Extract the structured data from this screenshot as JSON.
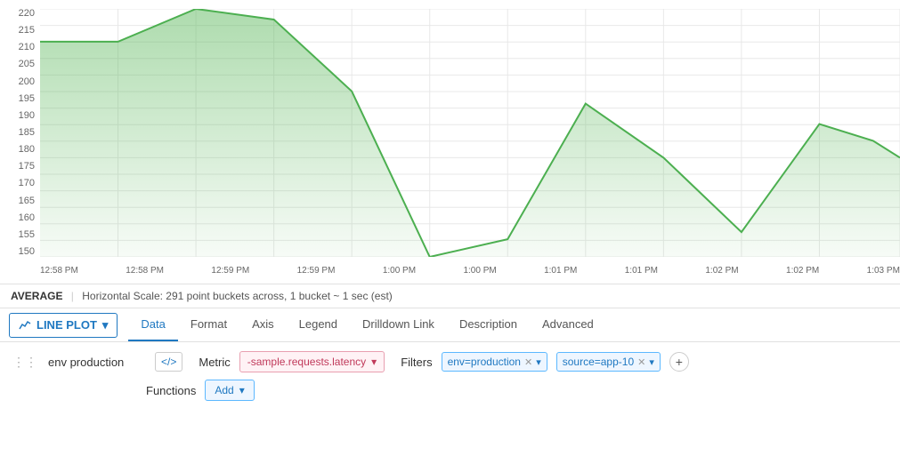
{
  "chart": {
    "y_labels": [
      "220",
      "215",
      "210",
      "205",
      "200",
      "195",
      "190",
      "185",
      "180",
      "175",
      "170",
      "165",
      "160",
      "155",
      "150"
    ],
    "x_labels": [
      "12:58 PM",
      "12:58 PM",
      "12:59 PM",
      "12:59 PM",
      "1:00 PM",
      "1:00 PM",
      "1:01 PM",
      "1:01 PM",
      "1:02 PM",
      "1:02 PM",
      "1:03 PM"
    ],
    "stats": "AVERAGE",
    "scale_info": "Horizontal Scale: 291 point buckets across, 1 bucket ~ 1 sec (est)"
  },
  "tabs": {
    "chart_type_label": "LINE PLOT",
    "items": [
      "Data",
      "Format",
      "Axis",
      "Legend",
      "Drilldown Link",
      "Description",
      "Advanced"
    ],
    "active": "Data"
  },
  "bottom": {
    "series_name": "env production",
    "metric_label": "Metric",
    "metric_value": "-sample.requests.latency",
    "filters_label": "Filters",
    "filter1": "env=production",
    "filter2": "source=app-10",
    "functions_label": "Functions",
    "functions_value": "Add"
  }
}
